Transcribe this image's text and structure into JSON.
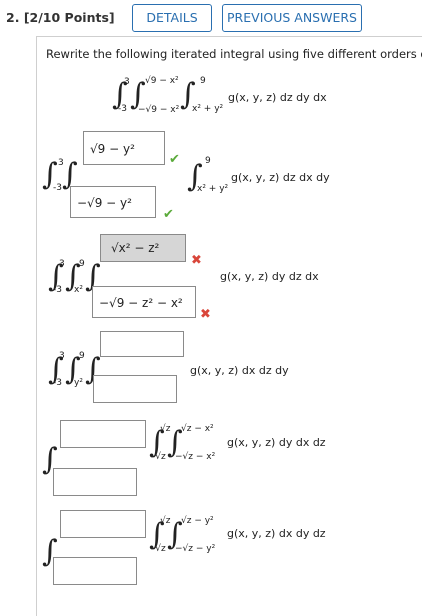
{
  "question": {
    "number": "2.",
    "points": "[2/10 Points]",
    "details_button": "DETAILS",
    "previous_button": "PREVIOUS ANSWERS",
    "prompt": "Rewrite the following iterated integral using five different orders of ir"
  },
  "original": {
    "outer_upper": "3",
    "outer_lower": "-3",
    "mid_upper": "√9 − x²",
    "mid_lower": "−√9 − x²",
    "inner_upper": "9",
    "inner_lower": "x² + y²",
    "integrand": "g(x, y, z) dz dy dx"
  },
  "orders": [
    {
      "integrand": "g(x, y, z) dz dx dy",
      "outer_upper": "3",
      "outer_lower": "-3",
      "box_upper": "√9 − y²",
      "box_lower": "−√9 − y²",
      "inner_upper": "9",
      "inner_lower": "x² + y²",
      "upper_status": "correct",
      "lower_status": "correct"
    },
    {
      "integrand": "g(x, y, z) dy dz dx",
      "outer_upper": "3",
      "outer_lower": "-3",
      "mid_upper": "9",
      "mid_lower": "x²",
      "box_upper": "√x² − z²",
      "box_lower": "−√9 − z² − x²",
      "upper_status": "incorrect",
      "lower_status": "incorrect"
    },
    {
      "integrand": "g(x, y, z) dx dz dy",
      "outer_upper": "3",
      "outer_lower": "-3",
      "mid_upper": "9",
      "mid_lower": "y²",
      "box_upper": "",
      "box_lower": ""
    },
    {
      "integrand": "g(x, y, z) dy dx dz",
      "mid_upper": "√z",
      "mid_lower": "-√z",
      "inner_upper": "√z − x²",
      "inner_lower": "−√z − x²",
      "box_upper": "",
      "box_lower": ""
    },
    {
      "integrand": "g(x, y, z) dx dy dz",
      "mid_upper": "√z",
      "mid_lower": "-√z",
      "inner_upper": "√z − y²",
      "inner_lower": "−√z − y²",
      "box_upper": "",
      "box_lower": ""
    }
  ],
  "marks": {
    "correct": "✔",
    "incorrect": "✖"
  },
  "colors": {
    "accent": "#2a6fb0",
    "correct": "#5aaa3a",
    "incorrect": "#d9463a"
  }
}
